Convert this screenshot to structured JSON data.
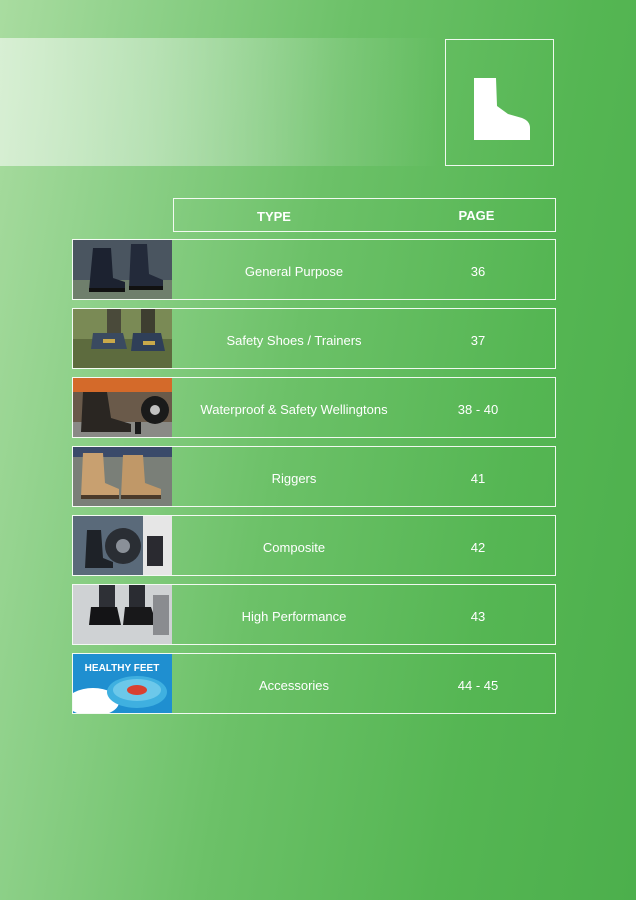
{
  "icon": "boot-icon",
  "table": {
    "header_type": "TYPE",
    "header_page": "PAGE",
    "rows": [
      {
        "type": "General Purpose",
        "page": "36",
        "image": "black-work-boots-photo"
      },
      {
        "type": "Safety Shoes / Trainers",
        "page": "37",
        "image": "safety-trainers-photo"
      },
      {
        "type": "Waterproof & Safety Wellingtons",
        "page": "38 - 40",
        "image": "wellington-boot-photo"
      },
      {
        "type": "Riggers",
        "page": "41",
        "image": "tan-rigger-boots-photo"
      },
      {
        "type": "Composite",
        "page": "42",
        "image": "composite-boots-photo"
      },
      {
        "type": "High Performance",
        "page": "43",
        "image": "high-performance-boots-photo"
      },
      {
        "type": "Accessories",
        "page": "44 - 45",
        "image": "healthy-feet-tin-photo"
      }
    ]
  },
  "accessory_label": "HEALTHY FEET",
  "colors": {
    "background": "#5cb85a",
    "text": "#ffffff"
  }
}
